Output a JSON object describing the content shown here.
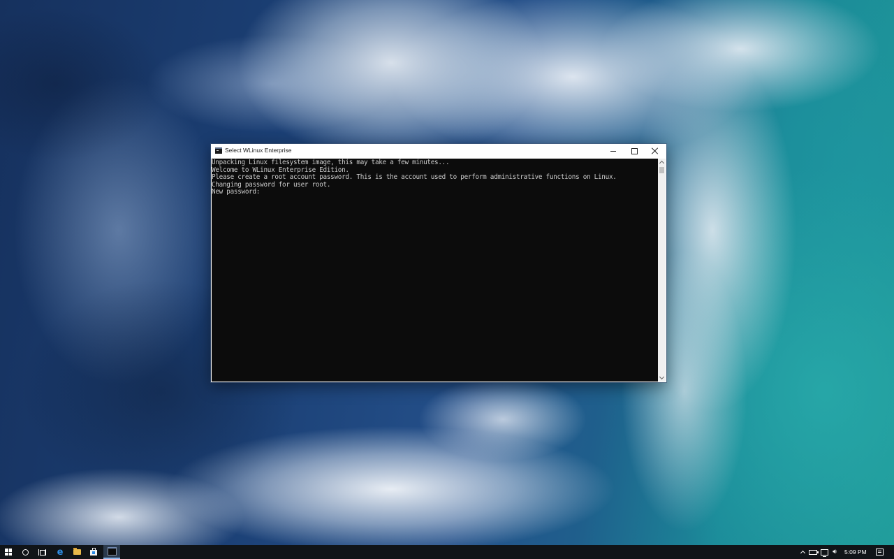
{
  "window": {
    "title": "Select WLinux Enterprise",
    "icon": "console-icon"
  },
  "console": {
    "lines": [
      "Unpacking Linux filesystem image, this may take a few minutes...",
      "Welcome to WLinux Enterprise Edition.",
      "Please create a root account password. This is the account used to perform administrative functions on Linux.",
      "Changing password for user root.",
      "New password:"
    ],
    "text_color": "#cccccc",
    "background_color": "#0c0c0c"
  },
  "taskbar": {
    "pinned": [
      "windows-start-icon",
      "cortana-search-icon",
      "task-view-icon",
      "edge-icon",
      "file-explorer-icon",
      "store-icon",
      "console-app-icon"
    ],
    "tray": [
      "chevron-up-icon",
      "battery-icon",
      "network-icon",
      "volume-icon",
      "keyboard-icon"
    ],
    "clock": "5:09 PM"
  },
  "colors": {
    "taskbar": "#101418",
    "accent": "#8ab4e6"
  }
}
